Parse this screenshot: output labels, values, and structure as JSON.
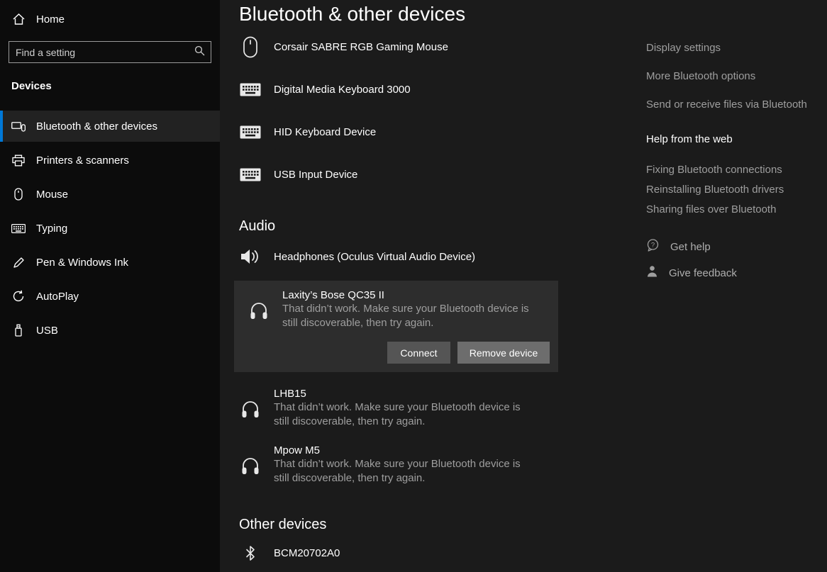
{
  "sidebar": {
    "home": "Home",
    "search_placeholder": "Find a setting",
    "section": "Devices",
    "items": [
      {
        "label": "Bluetooth & other devices"
      },
      {
        "label": "Printers & scanners"
      },
      {
        "label": "Mouse"
      },
      {
        "label": "Typing"
      },
      {
        "label": "Pen & Windows Ink"
      },
      {
        "label": "AutoPlay"
      },
      {
        "label": "USB"
      }
    ]
  },
  "main": {
    "title": "Bluetooth & other devices",
    "input_devices": [
      {
        "name": "Corsair SABRE RGB Gaming Mouse"
      },
      {
        "name": "Digital Media Keyboard 3000"
      },
      {
        "name": "HID Keyboard Device"
      },
      {
        "name": "USB Input Device"
      }
    ],
    "audio": {
      "heading": "Audio",
      "devices": [
        {
          "name": "Headphones (Oculus Virtual Audio Device)"
        },
        {
          "name": "Laxity’s Bose QC35 II",
          "status": "That didn’t work. Make sure your Bluetooth device is still discoverable, then try again."
        },
        {
          "name": "LHB15",
          "status": "That didn’t work. Make sure your Bluetooth device is still discoverable, then try again."
        },
        {
          "name": "Mpow M5",
          "status": "That didn’t work. Make sure your Bluetooth device is still discoverable, then try again."
        }
      ],
      "connect_button": "Connect",
      "remove_button": "Remove device"
    },
    "other": {
      "heading": "Other devices",
      "devices": [
        {
          "name": "BCM20702A0"
        }
      ]
    }
  },
  "related": {
    "links": [
      {
        "label": "Display settings"
      },
      {
        "label": "More Bluetooth options"
      },
      {
        "label": "Send or receive files via Bluetooth"
      }
    ],
    "help_heading": "Help from the web",
    "help_links": [
      {
        "label": "Fixing Bluetooth connections"
      },
      {
        "label": "Reinstalling Bluetooth drivers"
      },
      {
        "label": "Sharing files over Bluetooth"
      }
    ],
    "get_help": "Get help",
    "give_feedback": "Give feedback"
  },
  "colors": {
    "accent": "#0078d7",
    "panel_highlight": "#2d2d2d",
    "secondary_text": "#9e9e9e"
  }
}
